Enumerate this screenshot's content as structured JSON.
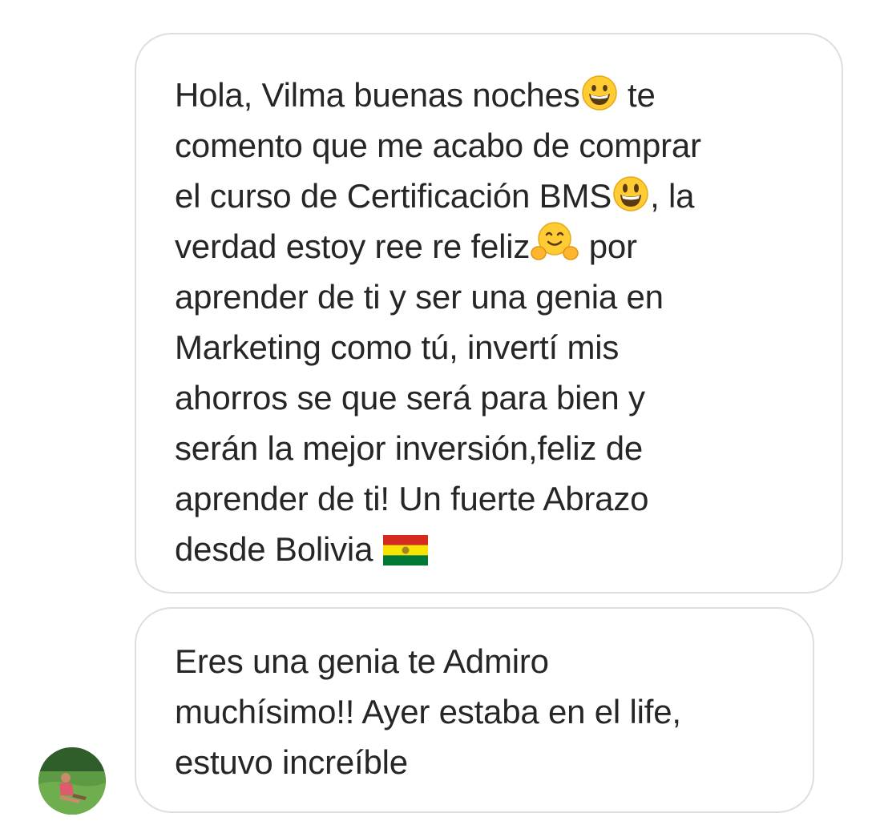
{
  "messages": [
    {
      "sender": "other",
      "lines": [
        [
          "Hola, Vilma buenas noches",
          " te"
        ],
        [
          "comento que me acabo de comprar"
        ],
        [
          "el curso de Certificación BMS",
          ", la"
        ],
        [
          "verdad estoy ree re feliz",
          " por"
        ],
        [
          "aprender de ti y ser una genia en"
        ],
        [
          "Marketing como tú, invertí mis"
        ],
        [
          "ahorros se que será para bien y"
        ],
        [
          "serán la mejor inversión,feliz de"
        ],
        [
          "aprender de ti! Un fuerte Abrazo"
        ],
        [
          "desde Bolivia "
        ]
      ],
      "emojis": [
        "grinning-face-icon",
        "smiling-face-big-eyes-icon",
        "hugging-face-icon",
        "bolivia-flag-icon"
      ]
    },
    {
      "sender": "other",
      "lines": [
        [
          "Eres una genia te Admiro"
        ],
        [
          "muchísimo!! Ayer estaba en el life,"
        ],
        [
          "estuvo increíble"
        ]
      ]
    }
  ],
  "colors": {
    "bubble_border": "#dedede",
    "text": "#262626",
    "background": "#ffffff"
  }
}
